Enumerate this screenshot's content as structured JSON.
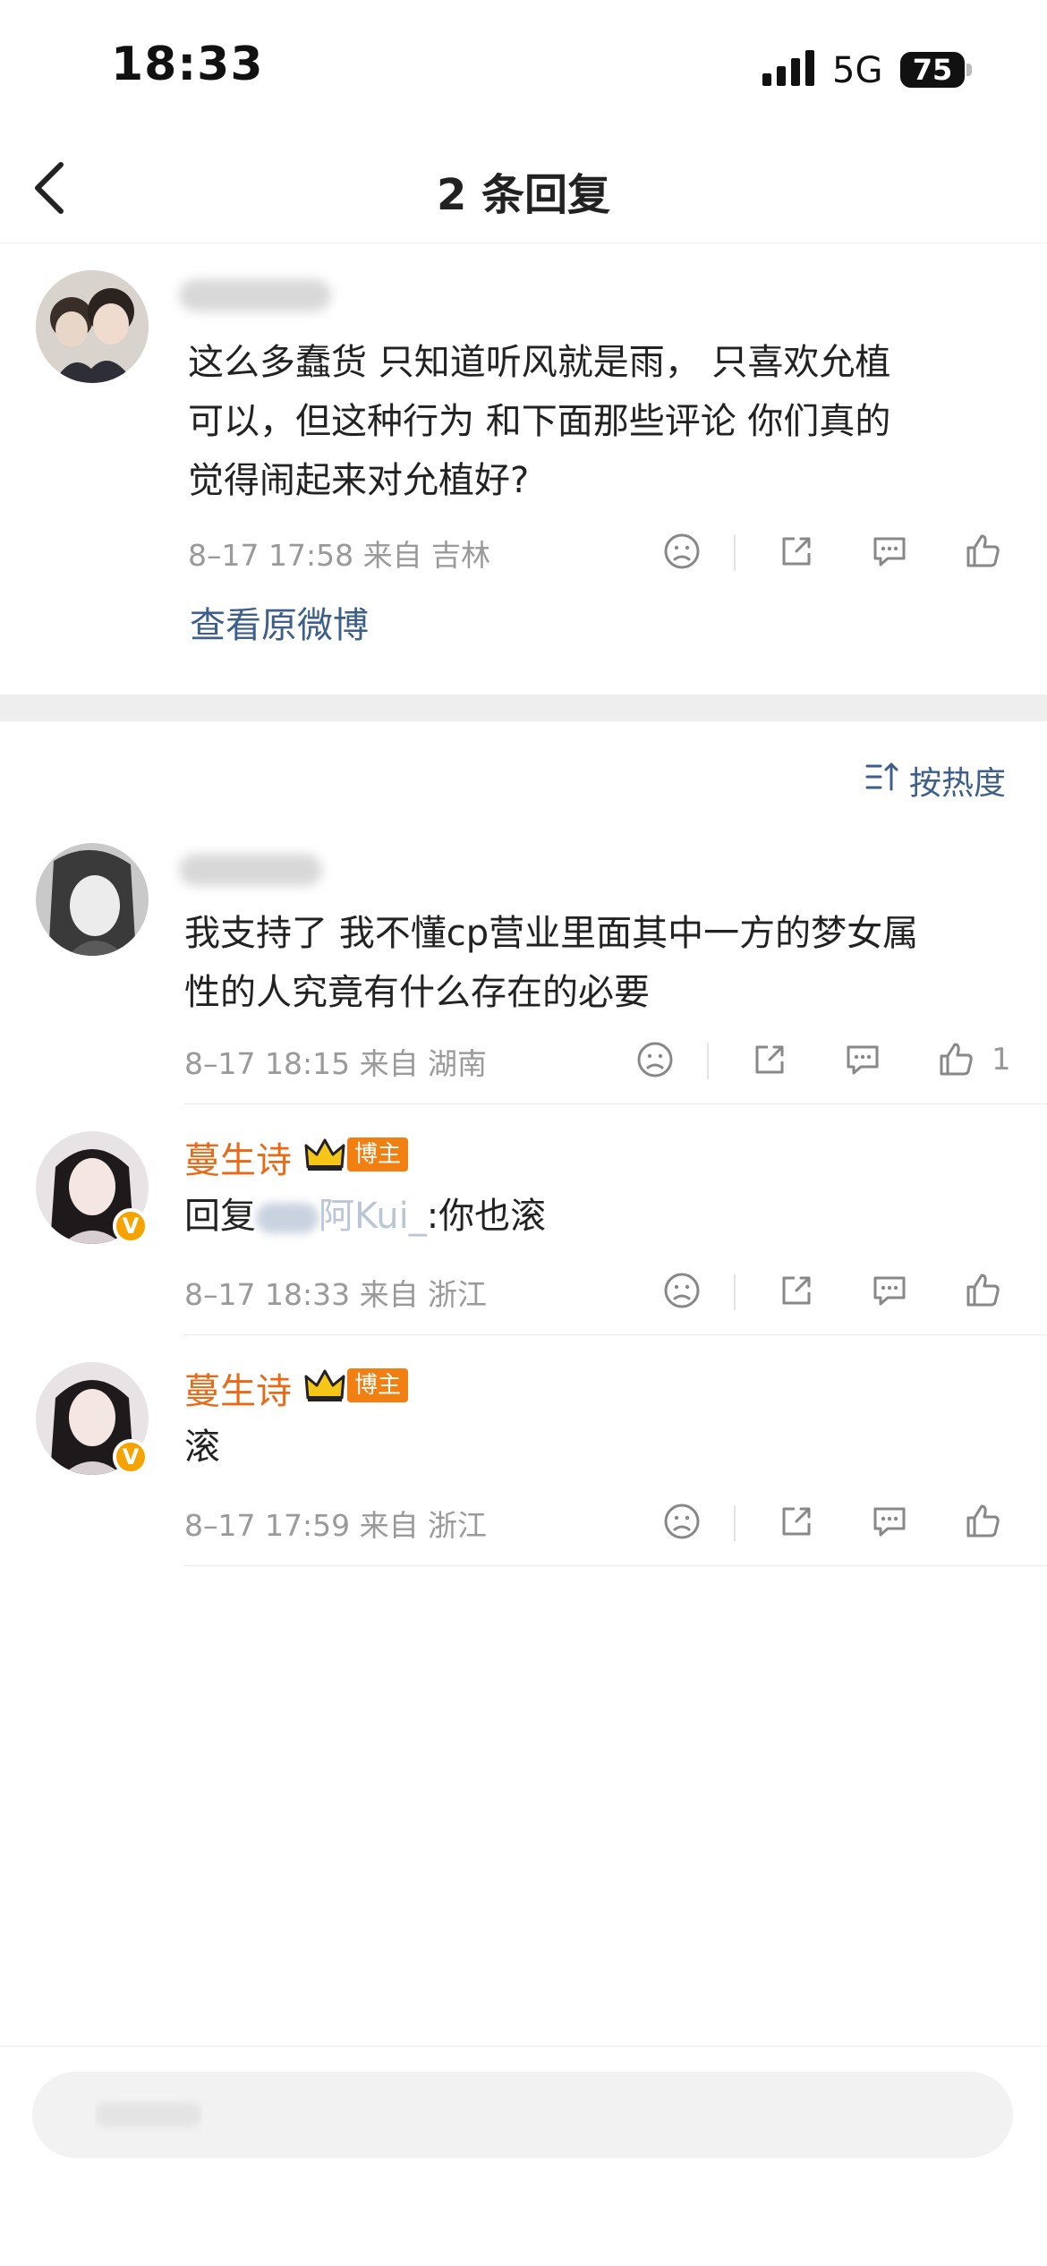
{
  "status_bar": {
    "time": "18:33",
    "network": "5G",
    "battery": "75"
  },
  "nav": {
    "title": "2 条回复"
  },
  "original_comment": {
    "text_lines": [
      "这么多蠢货 只知道听风就是雨， 只喜欢允植",
      "可以，但这种行为 和下面那些评论 你们真的",
      "觉得闹起来对允植好?"
    ],
    "meta": "8–17 17:58  来自 吉林",
    "view_original": "查看原微博"
  },
  "sort": {
    "label": "按热度"
  },
  "replies": [
    {
      "text_lines": [
        "我支持了 我不懂cp营业里面其中一方的梦女属",
        "性的人究竟有什么存在的必要"
      ],
      "meta": "8–17 18:15  来自 湖南",
      "like_count": "1"
    },
    {
      "name": "蔓生诗",
      "badge": "博主",
      "reply_prefix": "回复",
      "mention": "阿Kui_",
      "reply_text": ":你也滚",
      "meta": "8–17 18:33  来自 浙江"
    },
    {
      "name": "蔓生诗",
      "badge": "博主",
      "text": "滚",
      "meta": "8–17 17:59  来自 浙江"
    }
  ],
  "colors": {
    "link": "#3e5f8a",
    "vip_name": "#e86a16",
    "badge": "#f27f12",
    "meta": "#9a9a9a"
  }
}
